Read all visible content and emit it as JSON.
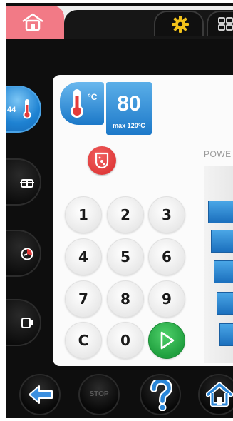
{
  "temperature": {
    "current_badge": "44",
    "unit": "°C",
    "setpoint": "80",
    "max_label": "max 120°C"
  },
  "power": {
    "label": "POWE"
  },
  "keypad": {
    "keys": [
      "1",
      "2",
      "3",
      "4",
      "5",
      "6",
      "7",
      "8",
      "9",
      "C",
      "0"
    ]
  },
  "bottom_bar": {
    "stop_label": "STOP"
  },
  "icons": {
    "top_home": "home-icon",
    "settings": "gear-icon",
    "grid": "grid-icon",
    "temperature": "thermometer-icon",
    "stir": "stir-pot-icon",
    "pot": "pot-icon",
    "timer": "timer-icon",
    "cup": "cup-icon",
    "start": "play-icon",
    "back": "arrow-left-icon",
    "help": "question-icon",
    "home": "home-icon"
  },
  "colors": {
    "home_tab": "#f27a86",
    "accent_blue": "#1e82d2",
    "start_green": "#20a03f",
    "stir_red": "#d92b2b",
    "gear_yellow": "#f2c21a"
  }
}
